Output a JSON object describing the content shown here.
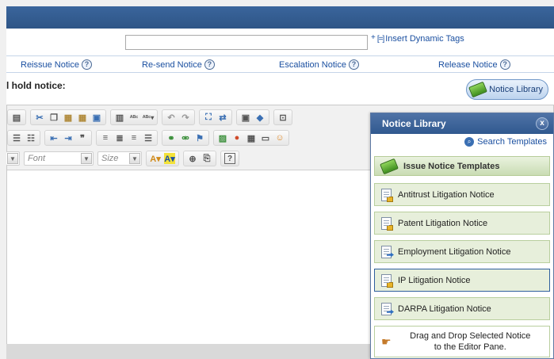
{
  "tags": {
    "input_value": "",
    "insert_label": "Insert Dynamic Tags",
    "plus": "+",
    "bracket": "[=]"
  },
  "tabs": [
    {
      "label": "Reissue Notice"
    },
    {
      "label": "Re-send Notice"
    },
    {
      "label": "Escalation Notice"
    },
    {
      "label": "Release Notice"
    }
  ],
  "help_glyph": "?",
  "editor": {
    "label": "l hold notice:",
    "font_placeholder": "Font",
    "size_placeholder": "Size"
  },
  "library_button": {
    "label": "Notice Library"
  },
  "panel": {
    "title": "Notice Library",
    "close": "x",
    "search_label": "Search Templates",
    "section_title": "Issue Notice Templates",
    "items": [
      {
        "label": "Antitrust Litigation Notice",
        "icon": "doc-lock-icon"
      },
      {
        "label": "Patent Litigation Notice",
        "icon": "doc-lock-icon"
      },
      {
        "label": "Employment Litigation Notice",
        "icon": "doc-arrow-icon"
      },
      {
        "label": "IP Litigation Notice",
        "icon": "doc-lock-icon"
      },
      {
        "label": "DARPA Litigation Notice",
        "icon": "doc-arrow-icon"
      }
    ],
    "drag_drop_line1": "Drag and Drop Selected Notice",
    "drag_drop_line2": "to the Editor Pane."
  },
  "colors": {
    "header_bar": "#2e5586",
    "link": "#1a4fa0",
    "panel_item_bg": "#e7efdb",
    "panel_border": "#5d79a3"
  }
}
